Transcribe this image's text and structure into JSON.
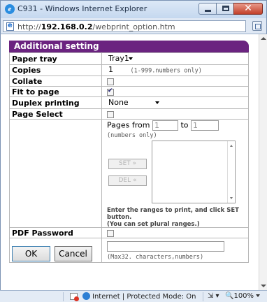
{
  "window": {
    "title": "C931 - Windows Internet Explorer",
    "url_prefix": "http://",
    "url_host": "192.168.0.2",
    "url_path": "/webprint_option.htm"
  },
  "panel": {
    "title": "Additional setting",
    "rows": {
      "paper_tray": {
        "label": "Paper tray",
        "value": "Tray1"
      },
      "copies": {
        "label": "Copies",
        "value": "1",
        "hint": "(1-999.numbers only)"
      },
      "collate": {
        "label": "Collate",
        "checked": false
      },
      "fit_to_page": {
        "label": "Fit to page",
        "checked": true
      },
      "duplex": {
        "label": "Duplex printing",
        "value": "None"
      },
      "page_select": {
        "label": "Page Select",
        "checked": false
      }
    },
    "pages": {
      "from_label": "Pages from",
      "from_value": "1",
      "to_label": "to",
      "to_value": "1",
      "numbers_hint": "(numbers only)",
      "set_button": "SET »",
      "del_button": "DEL «",
      "note_line1": "Enter the ranges to print, and click SET button.",
      "note_line2": "(You can set plural ranges.)"
    },
    "pdf_password": {
      "label": "PDF Password",
      "checked": false,
      "value": "",
      "hint": "(Max32. characters,numbers)"
    }
  },
  "buttons": {
    "ok": "OK",
    "cancel": "Cancel"
  },
  "status": {
    "zone": "Internet | Protected Mode: On",
    "zoom": "100%"
  }
}
